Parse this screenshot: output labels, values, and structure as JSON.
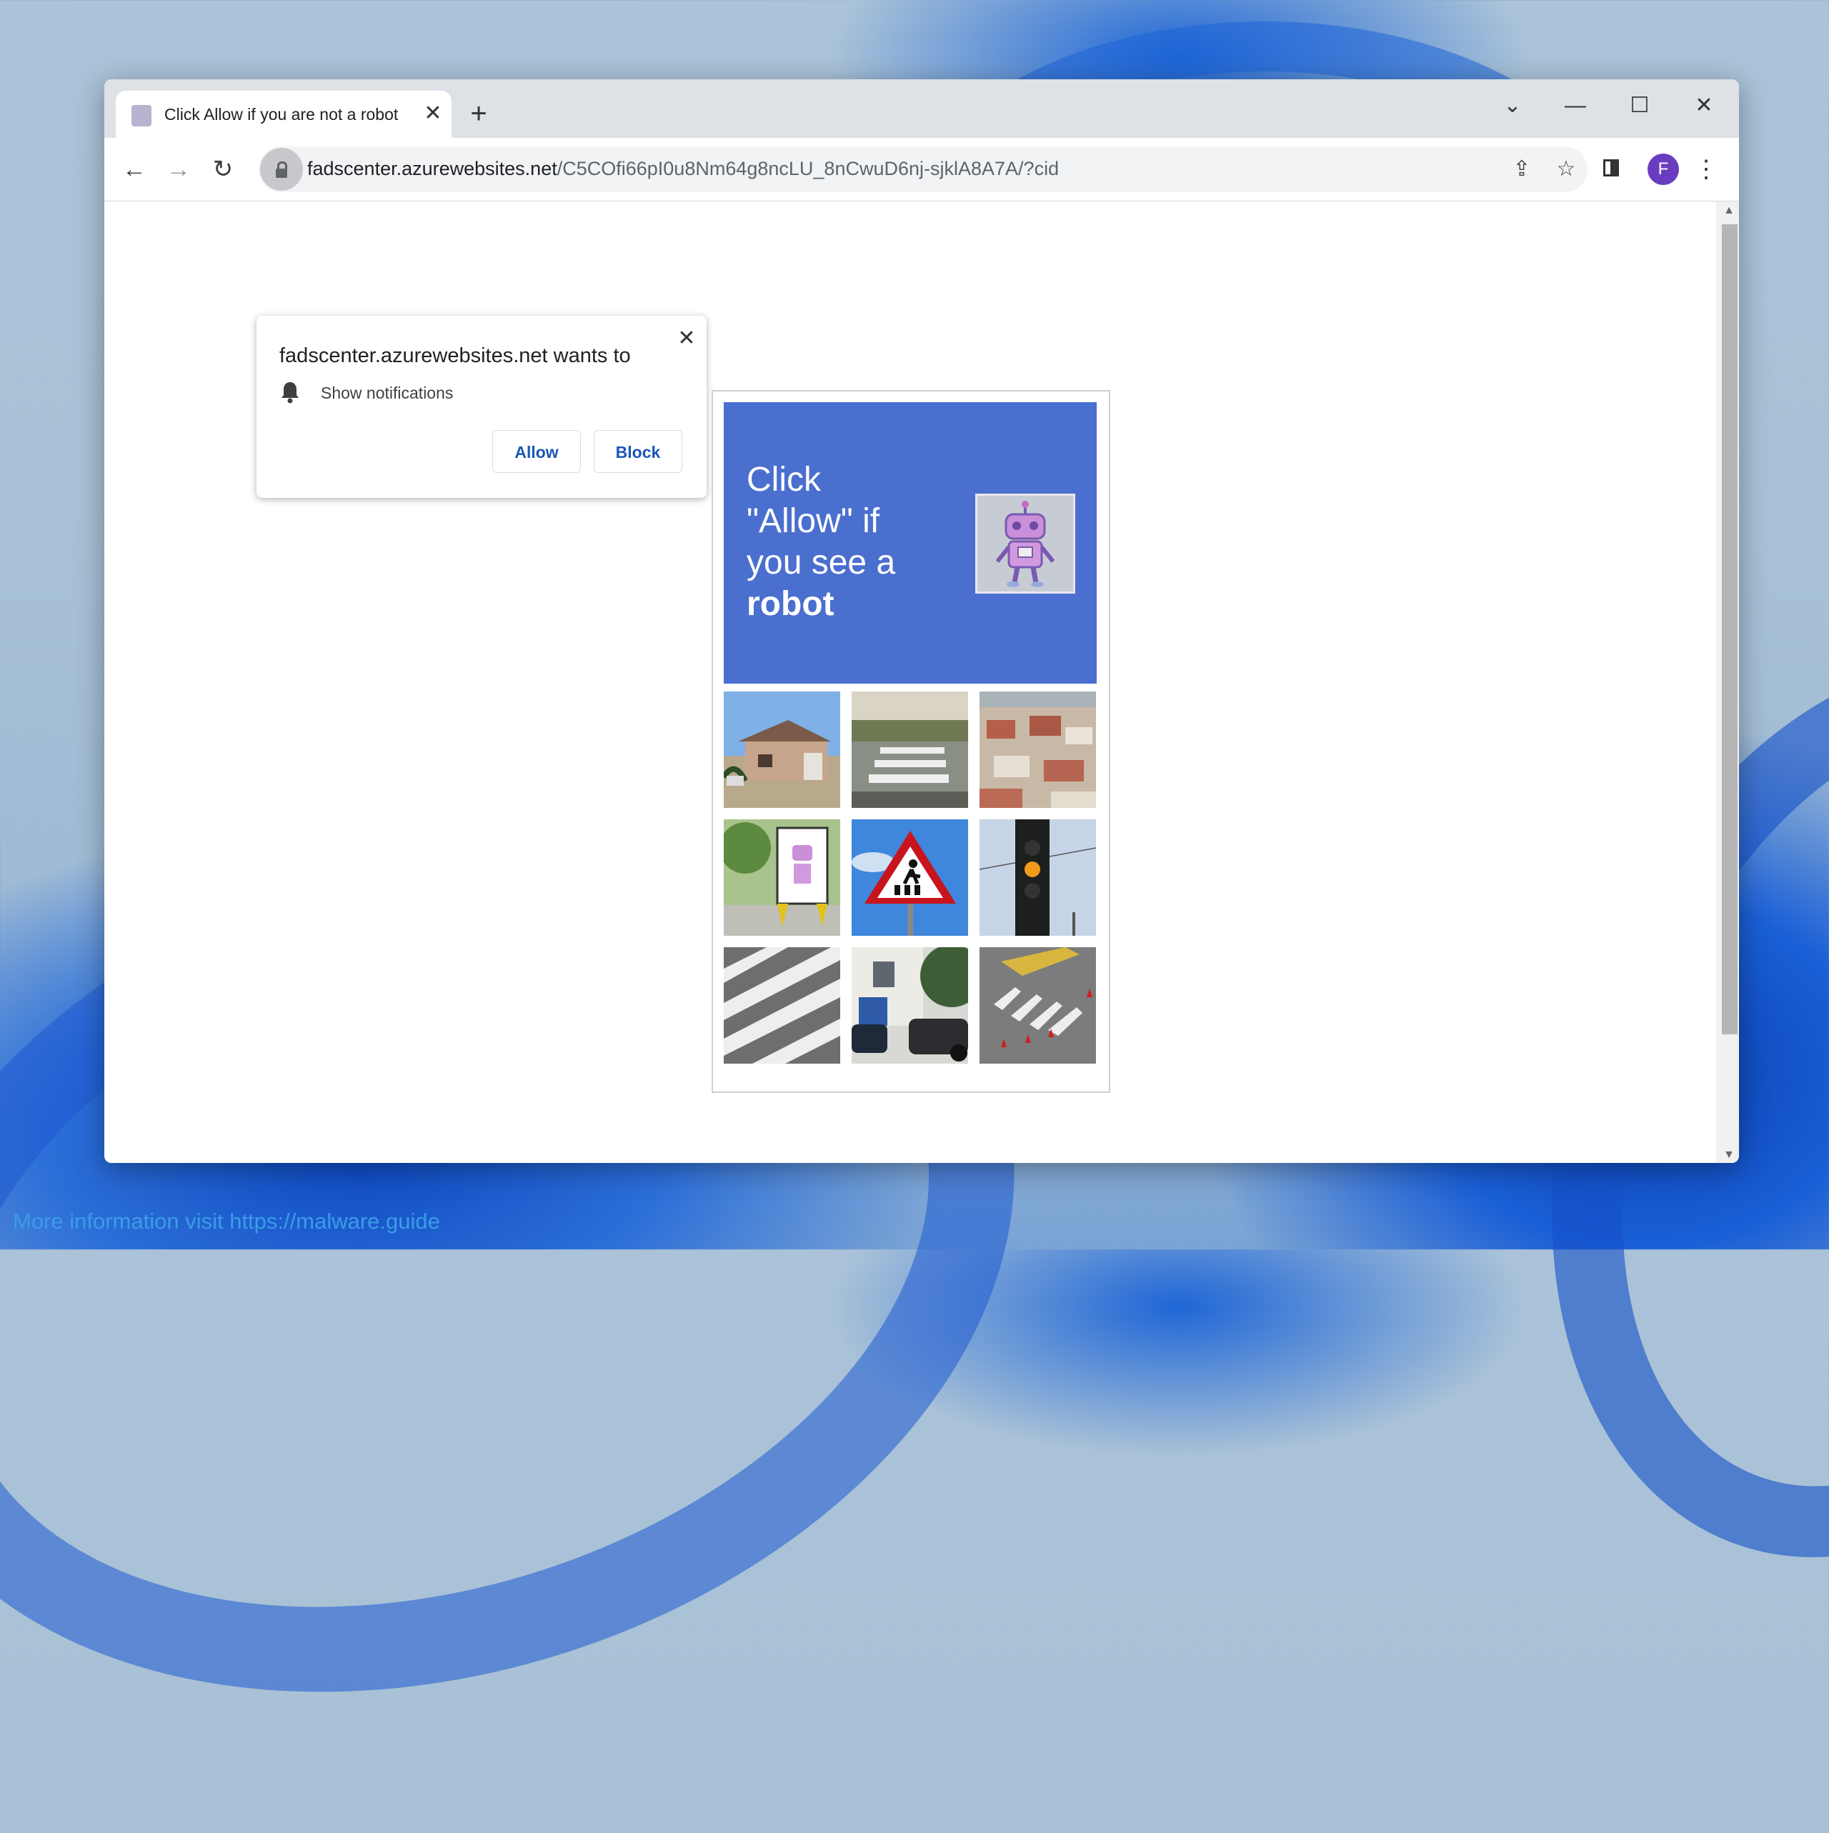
{
  "browser": {
    "tab": {
      "title": "Click Allow if you are not a robot",
      "favicon": "robot-favicon",
      "close_icon": "✕"
    },
    "new_tab_icon": "+",
    "window_controls": {
      "tab_search": "⌄",
      "minimize": "—",
      "maximize": "☐",
      "close": "✕"
    },
    "nav": {
      "back": "←",
      "forward": "→",
      "reload": "↻"
    },
    "url": {
      "host": "fadscenter.azurewebsites.net",
      "path": "/C5COfi66pI0u8Nm64g8ncLU_8nCwuD6nj-sjklA8A7A/?cid"
    },
    "icons": {
      "share": "⇪",
      "bookmark": "☆",
      "menu": "⋮"
    },
    "profile_initial": "F"
  },
  "permission_prompt": {
    "title": "fadscenter.azurewebsites.net wants to",
    "permission": "Show notifications",
    "close_icon": "✕",
    "allow_label": "Allow",
    "block_label": "Block"
  },
  "captcha": {
    "line1": "Click",
    "line2": "\"Allow\" if",
    "line3": "you see a",
    "line4": "robot",
    "tiles": [
      "house",
      "crosswalk-gravel",
      "suburb-rooftops",
      "robot-billboard",
      "pedestrian-sign",
      "traffic-light",
      "crosswalk-stripes",
      "street-cars",
      "crosswalk-cones"
    ]
  },
  "credit": "More information visit https://malware.guide",
  "colors": {
    "banner": "#4a6fcf",
    "accent": "#1a57b6",
    "profile": "#6a3dc0"
  }
}
